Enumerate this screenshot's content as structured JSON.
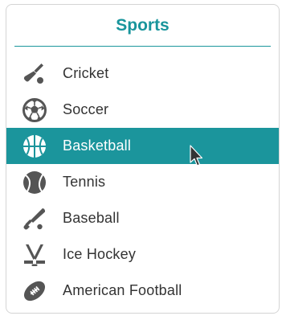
{
  "panel": {
    "title": "Sports"
  },
  "items": [
    {
      "label": "Cricket",
      "icon": "cricket-icon",
      "selected": false
    },
    {
      "label": "Soccer",
      "icon": "soccer-ball-icon",
      "selected": false
    },
    {
      "label": "Basketball",
      "icon": "basketball-icon",
      "selected": true
    },
    {
      "label": "Tennis",
      "icon": "tennis-ball-icon",
      "selected": false
    },
    {
      "label": "Baseball",
      "icon": "baseball-bat-icon",
      "selected": false
    },
    {
      "label": "Ice Hockey",
      "icon": "hockey-sticks-icon",
      "selected": false
    },
    {
      "label": "American Football",
      "icon": "american-football-icon",
      "selected": false
    }
  ],
  "colors": {
    "accent": "#1b959c",
    "icon": "#555555",
    "text": "#333333"
  }
}
